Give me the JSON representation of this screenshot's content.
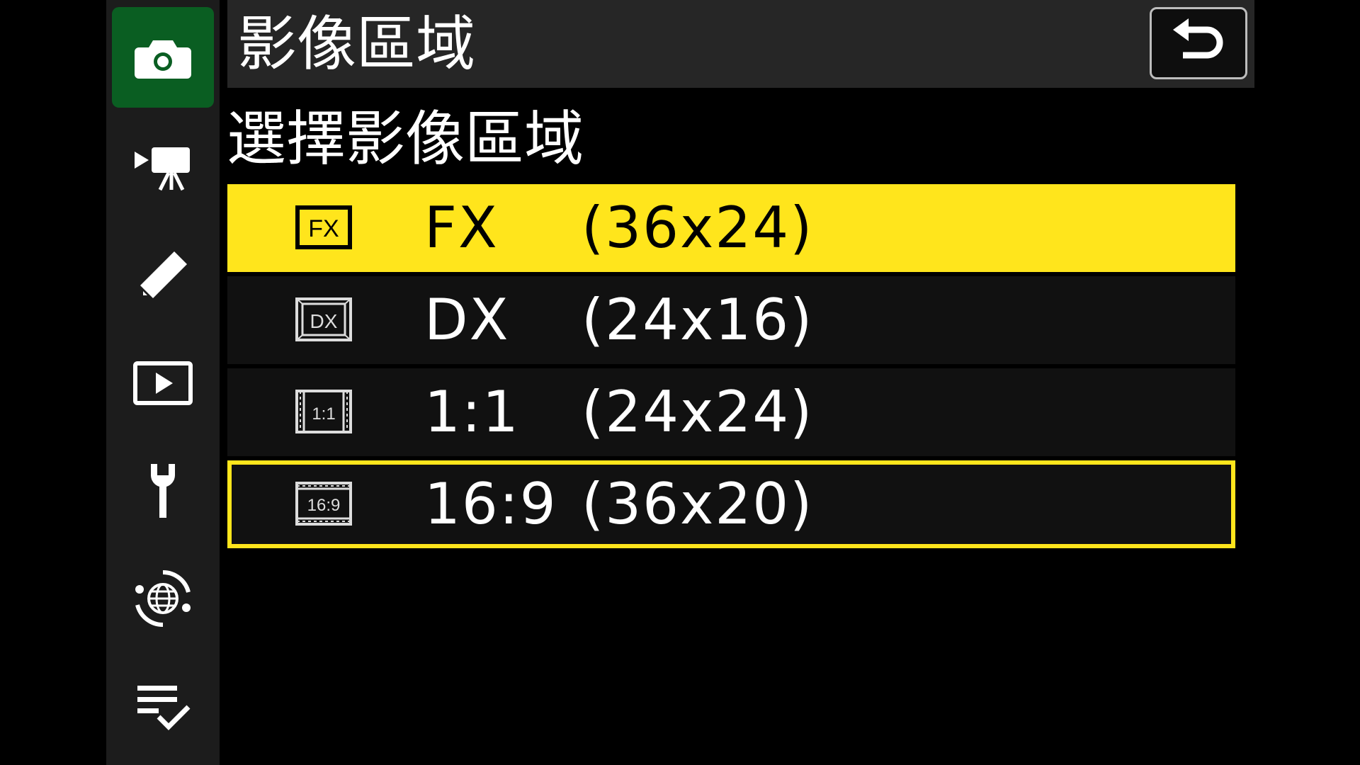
{
  "header": {
    "title": "影像區域",
    "back_icon": "return-icon"
  },
  "subtitle": "選擇影像區域",
  "sidebar": {
    "items": [
      {
        "icon": "camera-icon",
        "active": true
      },
      {
        "icon": "movie-camera-icon",
        "active": false
      },
      {
        "icon": "pencil-icon",
        "active": false
      },
      {
        "icon": "playback-icon",
        "active": false
      },
      {
        "icon": "wrench-icon",
        "active": false
      },
      {
        "icon": "network-globe-icon",
        "active": false
      },
      {
        "icon": "my-menu-checklist-icon",
        "active": false
      }
    ]
  },
  "options": [
    {
      "badge": "FX",
      "name": "FX",
      "size": "(36x24)",
      "state": "selected"
    },
    {
      "badge": "DX",
      "name": "DX",
      "size": "(24x16)",
      "state": "normal"
    },
    {
      "badge": "1:1",
      "name": "1:1",
      "size": "(24x24)",
      "state": "normal"
    },
    {
      "badge": "16:9",
      "name": "16:9",
      "size": "(36x20)",
      "state": "focused"
    }
  ],
  "colors": {
    "highlight": "#ffe51c",
    "active_tab": "#0a5e22",
    "sidebar_bg": "#1c1c1c",
    "header_bg": "#262626",
    "row_bg": "#111111"
  }
}
